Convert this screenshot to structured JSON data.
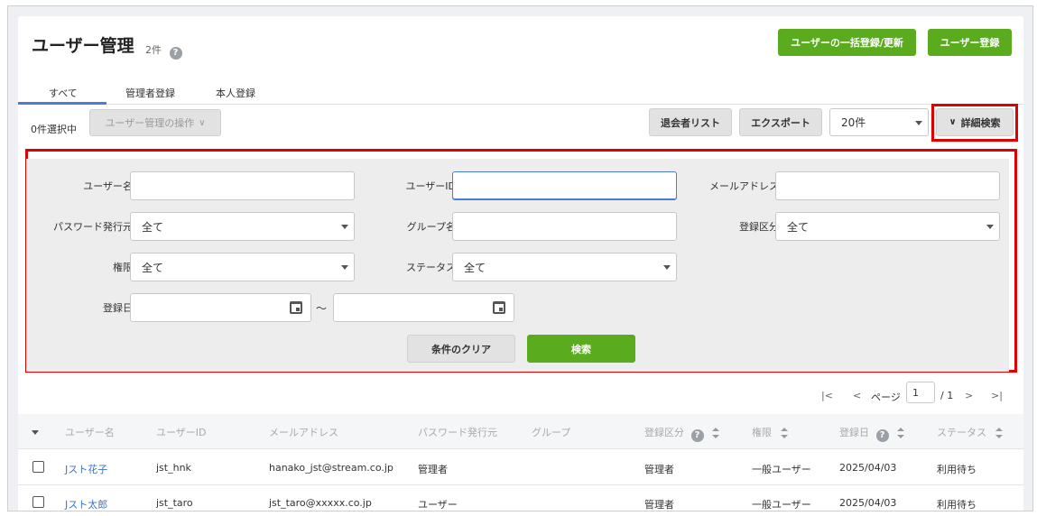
{
  "header": {
    "title": "ユーザー管理",
    "count": "2件",
    "help": "?",
    "bulk_button": "ユーザーの一括登録/更新",
    "register_button": "ユーザー登録"
  },
  "tabs": [
    {
      "label": "すべて"
    },
    {
      "label": "管理者登録"
    },
    {
      "label": "本人登録"
    }
  ],
  "toolbar": {
    "selected": "0件選択中",
    "operations": "ユーザー管理の操作",
    "operations_chevron": "∨",
    "retired_list": "退会者リスト",
    "export": "エクスポート",
    "per_page": "20件",
    "advanced_chevron": "∨",
    "advanced_search": "詳細検索"
  },
  "filters": {
    "username_label": "ユーザー名",
    "userid_label": "ユーザーID",
    "email_label": "メールアドレス",
    "password_label": "パスワード発行元",
    "password_value": "全て",
    "group_label": "グループ名",
    "regtype_label": "登録区分",
    "regtype_value": "全て",
    "role_label": "権限",
    "role_value": "全て",
    "status_label": "ステータス",
    "status_value": "全て",
    "regdate_label": "登録日",
    "tilde": "～",
    "clear_button": "条件のクリア",
    "search_button": "検索"
  },
  "pager": {
    "first": "|<",
    "prev": "<",
    "page_label": "ページ",
    "page_value": "1",
    "total": "/ 1",
    "next": ">",
    "last": ">|"
  },
  "table": {
    "headers": {
      "username": "ユーザー名",
      "userid": "ユーザーID",
      "email": "メールアドレス",
      "password": "パスワード発行元",
      "group": "グループ",
      "regtype": "登録区分",
      "role": "権限",
      "regdate": "登録日",
      "status": "ステータス"
    },
    "rows": [
      {
        "username": "Jスト花子",
        "userid": "jst_hnk",
        "email": "hanako_jst@stream.co.jp",
        "password": "管理者",
        "group": "",
        "regtype": "管理者",
        "role": "一般ユーザー",
        "regdate": "2025/04/03",
        "status": "利用待ち"
      },
      {
        "username": "Jスト太郎",
        "userid": "jst_taro",
        "email": "jst_taro@xxxxx.co.jp",
        "password": "ユーザー",
        "group": "",
        "regtype": "管理者",
        "role": "一般ユーザー",
        "regdate": "2025/04/03",
        "status": "利用待ち"
      }
    ]
  }
}
